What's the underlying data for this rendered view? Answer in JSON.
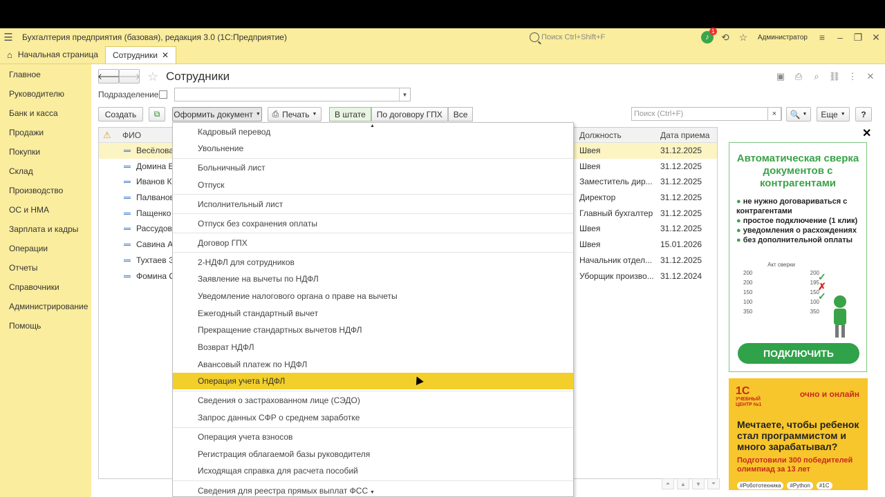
{
  "window": {
    "title": "Бухгалтерия предприятия (базовая), редакция 3.0  (1С:Предприятие)",
    "search_placeholder": "Поиск Ctrl+Shift+F",
    "notifications_count": "1",
    "user": "Администратор"
  },
  "tabs": [
    {
      "label": "Начальная страница"
    },
    {
      "label": "Сотрудники"
    }
  ],
  "sidebar": {
    "items": [
      {
        "label": "Главное"
      },
      {
        "label": "Руководителю"
      },
      {
        "label": "Банк и касса"
      },
      {
        "label": "Продажи"
      },
      {
        "label": "Покупки"
      },
      {
        "label": "Склад"
      },
      {
        "label": "Производство"
      },
      {
        "label": "ОС и НМА"
      },
      {
        "label": "Зарплата и кадры"
      },
      {
        "label": "Операции"
      },
      {
        "label": "Отчеты"
      },
      {
        "label": "Справочники"
      },
      {
        "label": "Администрирование"
      },
      {
        "label": "Помощь"
      }
    ]
  },
  "form": {
    "title": "Сотрудники",
    "subdivision_label": "Подразделение:",
    "create": "Создать",
    "make_doc": "Оформить документ",
    "print": "Печать",
    "filter": [
      "В штате",
      "По договору ГПХ",
      "Все"
    ],
    "search_placeholder": "Поиск (Ctrl+F)",
    "search_clear": "×",
    "more": "Еще",
    "help": "?"
  },
  "table": {
    "columns": {
      "name": "ФИО",
      "position": "Должность",
      "hire_date": "Дата приема"
    },
    "rows": [
      {
        "name": "Весёлова",
        "position": "Швея",
        "date": "31.12.2025"
      },
      {
        "name": "Домина Е.",
        "position": "Швея",
        "date": "31.12.2025"
      },
      {
        "name": "Иванов Ко",
        "position": "Заместитель дир...",
        "date": "31.12.2025"
      },
      {
        "name": "Палванова",
        "position": "Директор",
        "date": "31.12.2025"
      },
      {
        "name": "Пащенко А",
        "position": "Главный бухгалтер",
        "date": "31.12.2025"
      },
      {
        "name": "Рассудова",
        "position": "Швея",
        "date": "31.12.2025"
      },
      {
        "name": "Савина Ал",
        "position": "Швея",
        "date": "15.01.2026"
      },
      {
        "name": "Тухтаев Эд",
        "position": "Начальник отдел...",
        "date": "31.12.2025"
      },
      {
        "name": "Фомина С",
        "position": "Уборщик произво...",
        "date": "31.12.2024"
      }
    ]
  },
  "menu": {
    "items": [
      "Кадровый перевод",
      "Увольнение",
      "Больничный лист",
      "Отпуск",
      "Исполнительный лист",
      "Отпуск без сохранения оплаты",
      "Договор ГПХ",
      "2-НДФЛ для сотрудников",
      "Заявление на вычеты по НДФЛ",
      "Уведомление налогового органа о праве на вычеты",
      "Ежегодный стандартный вычет",
      "Прекращение стандартных вычетов НДФЛ",
      "Возврат НДФЛ",
      "Авансовый платеж по НДФЛ",
      "Операция учета НДФЛ",
      "Сведения о застрахованном лице (СЭДО)",
      "Запрос данных СФР о среднем заработке",
      "Операция учета взносов",
      "Регистрация облагаемой базы руководителя",
      "Исходящая справка для расчета пособий",
      "Сведения для реестра прямых выплат ФСС"
    ],
    "highlighted": "Операция учета НДФЛ"
  },
  "ad1": {
    "headline": "Автоматическая сверка документов с контрагентами",
    "bullets": [
      "не нужно договариваться с контрагентами",
      "простое подключение (1 клик)",
      "уведомления о расхождениях",
      "без дополнительной оплаты"
    ],
    "act_title": "Акт сверки",
    "act_rows": [
      [
        "200",
        "200"
      ],
      [
        "200",
        "195"
      ],
      [
        "150",
        "150"
      ],
      [
        "100",
        "100"
      ],
      [
        "350",
        "350"
      ]
    ],
    "button": "ПОДКЛЮЧИТЬ",
    "accent_color": "#3aa348"
  },
  "ad2": {
    "logo_text": "1С",
    "logo_sub": "УЧЕБНЫЙ ЦЕНТР №1",
    "badge": "очно и онлайн",
    "main": "Мечтаете, чтобы ребенок стал программистом и много зарабатывал?",
    "sub": "Подготовили 300 победителей олимпиад за 13 лет",
    "tags": [
      "#Робототехника",
      "#Python",
      "#1С"
    ],
    "bg_color": "#f7c62c"
  }
}
